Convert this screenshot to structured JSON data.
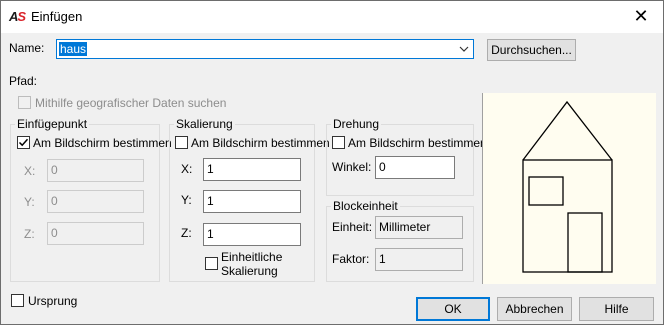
{
  "title_bar": {
    "app_icon_text": "AS",
    "title": "Einfügen",
    "close_glyph": "✕"
  },
  "name": {
    "label": "Name:",
    "value": "haus",
    "browse_button": "Durchsuchen..."
  },
  "path_label": "Pfad:",
  "geo_checkbox": {
    "label": "Mithilfe geografischer Daten suchen",
    "checked": false,
    "enabled": false
  },
  "insertion_point": {
    "title": "Einfügepunkt",
    "on_screen": {
      "label": "Am Bildschirm bestimmen",
      "checked": true
    },
    "x": {
      "label": "X:",
      "value": "0"
    },
    "y": {
      "label": "Y:",
      "value": "0"
    },
    "z": {
      "label": "Z:",
      "value": "0"
    }
  },
  "scale": {
    "title": "Skalierung",
    "on_screen": {
      "label": "Am Bildschirm bestimmen",
      "checked": false
    },
    "x": {
      "label": "X:",
      "value": "1"
    },
    "y": {
      "label": "Y:",
      "value": "1"
    },
    "z": {
      "label": "Z:",
      "value": "1"
    },
    "uniform": {
      "label_line1": "Einheitliche",
      "label_line2": "Skalierung",
      "checked": false
    }
  },
  "rotation": {
    "title": "Drehung",
    "on_screen": {
      "label": "Am Bildschirm bestimmen",
      "checked": false
    },
    "angle": {
      "label": "Winkel:",
      "value": "0"
    }
  },
  "block_unit": {
    "title": "Blockeinheit",
    "unit": {
      "label": "Einheit:",
      "value": "Millimeter"
    },
    "factor": {
      "label": "Faktor:",
      "value": "1"
    }
  },
  "origin_checkbox": {
    "label": "Ursprung",
    "checked": false
  },
  "buttons": {
    "ok": "OK",
    "cancel": "Abbrechen",
    "help": "Hilfe"
  },
  "icons": [
    "app-logo",
    "close-icon",
    "chevron-down-icon",
    "checkmark-icon",
    "block-preview"
  ]
}
